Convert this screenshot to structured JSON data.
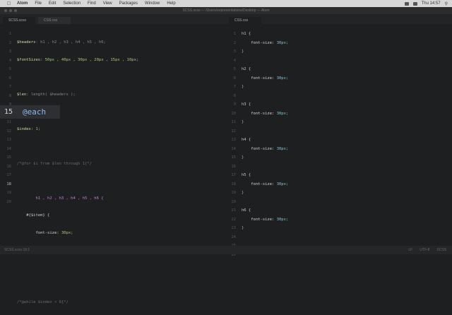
{
  "menubar": {
    "items": [
      "Atom",
      "File",
      "Edit",
      "Selection",
      "Find",
      "View",
      "Packages",
      "Window",
      "Help"
    ],
    "clock": "Thu 14:57"
  },
  "titlebar": {
    "title": "SCSS.scss — /Users/eepresentations/Desktop — Atom"
  },
  "tabs": {
    "left": [
      {
        "label": "SCSS.scss",
        "active": true
      },
      {
        "label": "CSS.css",
        "active": false
      }
    ],
    "right": [
      {
        "label": "CSS.css",
        "active": true
      }
    ]
  },
  "zoom": {
    "line_number": "15",
    "text": "@each"
  },
  "editor_left": {
    "line_numbers": [
      "1",
      "2",
      "3",
      "4",
      "5",
      "6",
      "7",
      "8",
      "9",
      "10",
      "11",
      "12",
      "13",
      "14",
      "15",
      "16",
      "17",
      "18",
      "19",
      "20"
    ],
    "current_line": "18",
    "lines": {
      "l1": {
        "var": "$headers",
        "rest": ": h1 , h2 , h3 , h4 , h5 , h6;"
      },
      "l2": {
        "var": "$fontSizes",
        "rest": ": 50px , 40px , 30px , 20px , 15px , 10px;"
      },
      "l4": {
        "var": "$len",
        "rest": ": length( $headers );"
      },
      "l6": {
        "var": "$index",
        "rest": ": 1;"
      },
      "l8": {
        "cmt": "/*@for $i from $len through 1{*/"
      },
      "l10": {
        "rest": "h1 , h2 , h3 , h4 , h5 , h6 {"
      },
      "l11": {
        "rest": "#{$item} {"
      },
      "l12": {
        "prop": "font-size:",
        "val": "30px;"
      },
      "l13": {
        "rest": "}"
      },
      "l16": {
        "cmt": "/*@while $index < 6{*/"
      }
    }
  },
  "editor_right": {
    "line_numbers": [
      "1",
      "2",
      "3",
      "4",
      "5",
      "6",
      "7",
      "8",
      "9",
      "10",
      "11",
      "12",
      "13",
      "14",
      "15",
      "16",
      "17",
      "18",
      "19",
      "20",
      "21",
      "22",
      "23",
      "24",
      "25",
      "26"
    ],
    "blocks": [
      {
        "sel": "h1 {",
        "prop": "font-size:",
        "val": "30px;",
        "close": "}"
      },
      {
        "sel": "h2 {",
        "prop": "font-size:",
        "val": "30px;",
        "close": "}"
      },
      {
        "sel": "h3 {",
        "prop": "font-size:",
        "val": "30px;",
        "close": "}"
      },
      {
        "sel": "h4 {",
        "prop": "font-size:",
        "val": "30px;",
        "close": "}"
      },
      {
        "sel": "h5 {",
        "prop": "font-size:",
        "val": "30px;",
        "close": "}"
      },
      {
        "sel": "h6 {",
        "prop": "font-size:",
        "val": "30px;",
        "close": "}"
      }
    ]
  },
  "statusbar": {
    "left": "SCSS.scss 18:1",
    "right": [
      "LF",
      "UTF-8",
      "SCSS"
    ]
  }
}
